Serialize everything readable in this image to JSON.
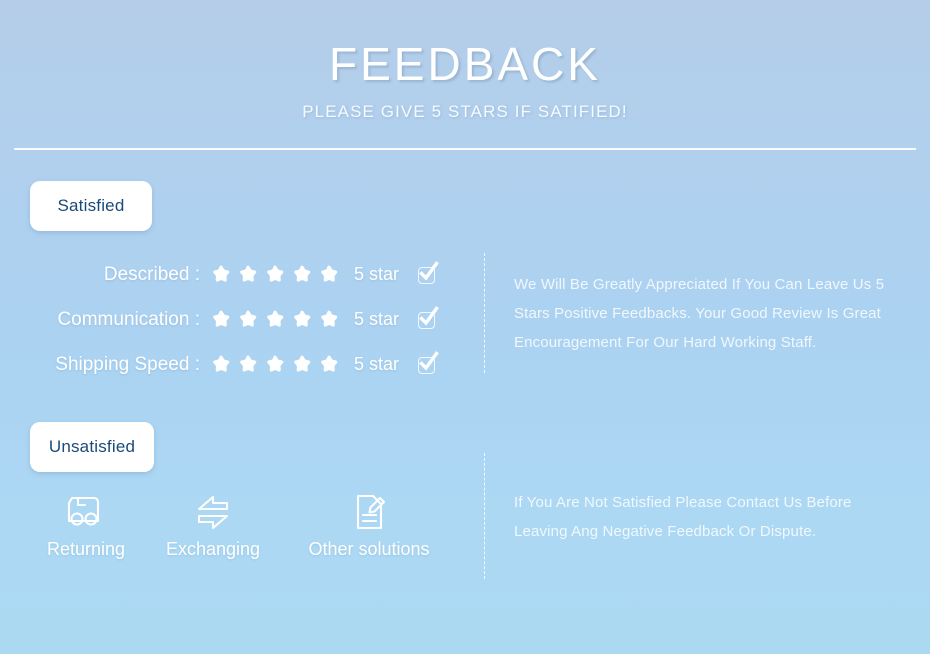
{
  "header": {
    "title": "FEEDBACK",
    "subtitle": "PLEASE GIVE 5 STARS IF SATIFIED!"
  },
  "satisfied": {
    "pill_label": "Satisfied",
    "note": "We Will Be Greatly Appreciated If You Can Leave Us 5 Stars Positive Feedbacks. Your Good Review Is Great Encouragement For Our Hard Working Staff.",
    "ratings": [
      {
        "label": "Described :",
        "stars": 5,
        "value": "5 star",
        "checked": true
      },
      {
        "label": "Communication :",
        "stars": 5,
        "value": "5 star",
        "checked": true
      },
      {
        "label": "Shipping Speed :",
        "stars": 5,
        "value": "5 star",
        "checked": true
      }
    ]
  },
  "unsatisfied": {
    "pill_label": "Unsatisfied",
    "note": "If You Are Not Satisfied Please Contact Us Before Leaving Ang Negative Feedback Or Dispute.",
    "solutions": [
      {
        "label": "Returning",
        "icon": "truck-icon"
      },
      {
        "label": "Exchanging",
        "icon": "exchange-arrows-icon"
      },
      {
        "label": "Other solutions",
        "icon": "document-pencil-icon"
      }
    ]
  },
  "colors": {
    "background_top": "#b5cde8",
    "background_bottom": "#abd9f2",
    "pill_background": "#ffffff",
    "pill_text": "#1b4a79",
    "text_primary": "#ffffff",
    "note_text": "rgba(255,255,255,0.82)"
  }
}
